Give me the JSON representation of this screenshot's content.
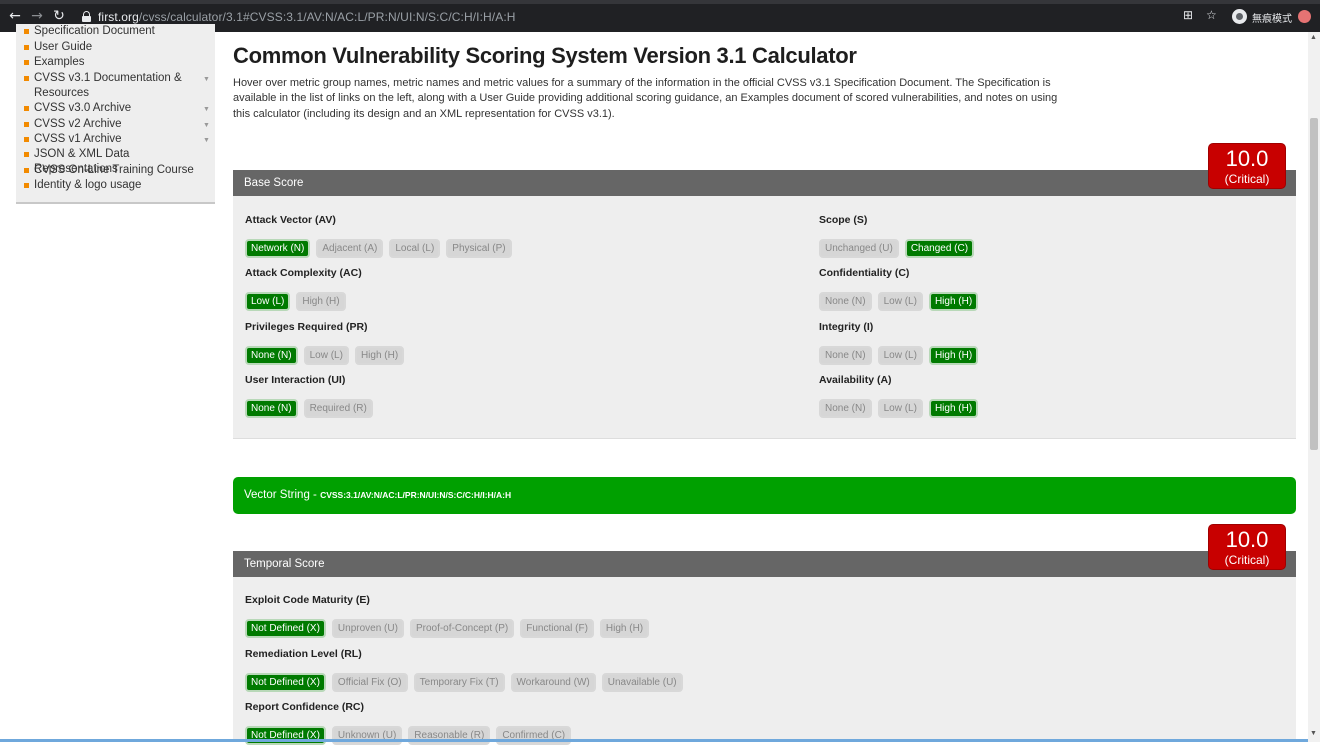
{
  "browser": {
    "url_host": "first.org",
    "url_path": "/cvss/calculator/3.1#CVSS:3.1/AV:N/AC:L/PR:N/UI:N/S:C/C:H/I:H/A:H",
    "profile_label": "無痕模式",
    "back_glyph": "←",
    "forward_glyph": "→",
    "reload_glyph": "↻",
    "translate_glyph": "⊞",
    "star_glyph": "☆"
  },
  "sidebar": {
    "items": [
      {
        "label": "Specification Document",
        "arrow": ""
      },
      {
        "label": "User Guide",
        "arrow": ""
      },
      {
        "label": "Examples",
        "arrow": ""
      },
      {
        "label": "CVSS v3.1 Documentation & Resources",
        "arrow": "▼"
      },
      {
        "label": "CVSS v3.0 Archive",
        "arrow": "▼"
      },
      {
        "label": "CVSS v2 Archive",
        "arrow": "▼"
      },
      {
        "label": "CVSS v1 Archive",
        "arrow": "▼"
      },
      {
        "label": "JSON & XML Data Representations",
        "arrow": ""
      },
      {
        "label": "CVSS On-Line Training Course",
        "arrow": ""
      },
      {
        "label": "Identity & logo usage",
        "arrow": ""
      }
    ]
  },
  "main": {
    "title": "Common Vulnerability Scoring System Version 3.1 Calculator",
    "intro": "Hover over metric group names, metric names and metric values for a summary of the information in the official CVSS v3.1 Specification Document. The Specification is available in the list of links on the left, along with a User Guide providing additional scoring guidance, an Examples document of scored vulnerabilities, and notes on using this calculator (including its design and an XML representation for CVSS v3.1)."
  },
  "base": {
    "header": "Base Score",
    "score": "10.0",
    "severity": "(Critical)",
    "metrics": {
      "av": {
        "label": "Attack Vector (AV)",
        "options": [
          "Network (N)",
          "Adjacent (A)",
          "Local (L)",
          "Physical (P)"
        ],
        "selected": 0
      },
      "ac": {
        "label": "Attack Complexity (AC)",
        "options": [
          "Low (L)",
          "High (H)"
        ],
        "selected": 0
      },
      "pr": {
        "label": "Privileges Required (PR)",
        "options": [
          "None (N)",
          "Low (L)",
          "High (H)"
        ],
        "selected": 0
      },
      "ui": {
        "label": "User Interaction (UI)",
        "options": [
          "None (N)",
          "Required (R)"
        ],
        "selected": 0
      },
      "s": {
        "label": "Scope (S)",
        "options": [
          "Unchanged (U)",
          "Changed (C)"
        ],
        "selected": 1
      },
      "c": {
        "label": "Confidentiality (C)",
        "options": [
          "None (N)",
          "Low (L)",
          "High (H)"
        ],
        "selected": 2
      },
      "i": {
        "label": "Integrity (I)",
        "options": [
          "None (N)",
          "Low (L)",
          "High (H)"
        ],
        "selected": 2
      },
      "a": {
        "label": "Availability (A)",
        "options": [
          "None (N)",
          "Low (L)",
          "High (H)"
        ],
        "selected": 2
      }
    }
  },
  "vector": {
    "label": "Vector String - ",
    "value": "CVSS:3.1/AV:N/AC:L/PR:N/UI:N/S:C/C:H/I:H/A:H"
  },
  "temporal": {
    "header": "Temporal Score",
    "score": "10.0",
    "severity": "(Critical)",
    "metrics": {
      "e": {
        "label": "Exploit Code Maturity (E)",
        "options": [
          "Not Defined (X)",
          "Unproven (U)",
          "Proof-of-Concept (P)",
          "Functional (F)",
          "High (H)"
        ],
        "selected": 0
      },
      "rl": {
        "label": "Remediation Level (RL)",
        "options": [
          "Not Defined (X)",
          "Official Fix (O)",
          "Temporary Fix (T)",
          "Workaround (W)",
          "Unavailable (U)"
        ],
        "selected": 0
      },
      "rc": {
        "label": "Report Confidence (RC)",
        "options": [
          "Not Defined (X)",
          "Unknown (U)",
          "Reasonable (R)",
          "Confirmed (C)"
        ],
        "selected": 0
      }
    }
  },
  "colors": {
    "selected": "#007a00",
    "vector_bar": "#00a000",
    "critical": "#c80000",
    "bullet": "#f28a00"
  }
}
